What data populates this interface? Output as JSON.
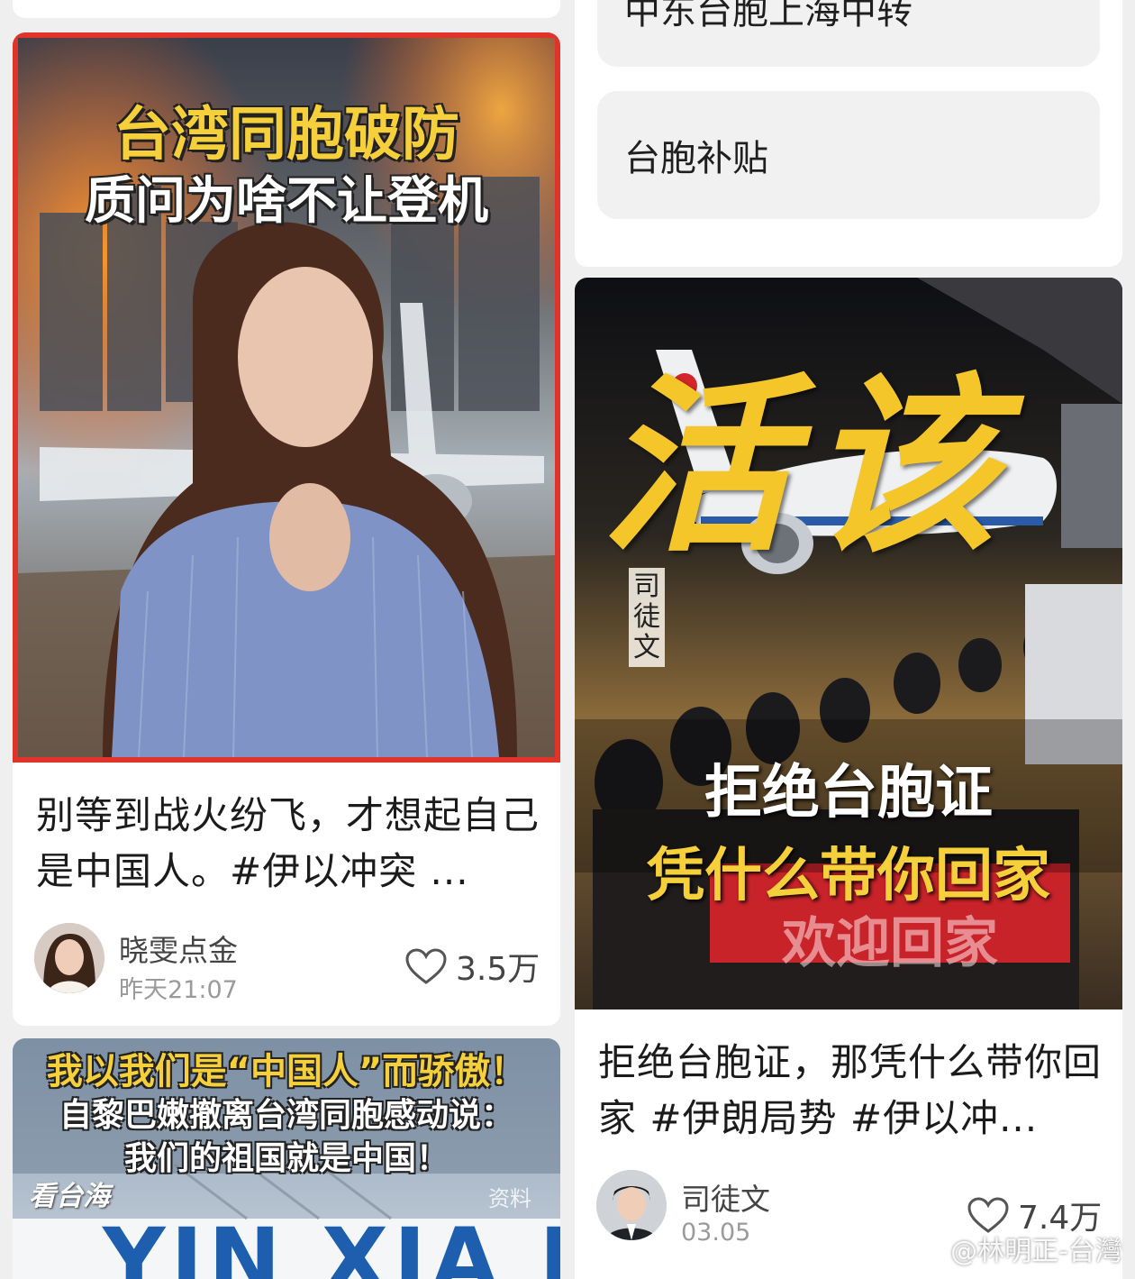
{
  "left_column": {
    "card1": {
      "cover_headline_1": "台湾同胞破防",
      "cover_headline_2": "质问为啥不让登机",
      "title": "别等到战火纷飞，才想起自己是中国人。#伊以冲突 ...",
      "author": "晓雯点金",
      "time": "昨天21:07",
      "likes": "3.5万"
    },
    "card2": {
      "cover_line_1": "我以我们是“中国人”而骄傲！",
      "cover_line_2": "自黎巴嫩撤离台湾同胞感动说：",
      "cover_line_3": "我们的祖国就是中国！",
      "cover_logo": "看台海",
      "cover_source": "资料",
      "cover_ship_text": "YIN XIA ME"
    }
  },
  "right_column": {
    "topic_chips": [
      "中东台胞上海中转",
      "台胞补贴"
    ],
    "card3": {
      "cover_calligraphy": "活该",
      "cover_vertical_name": "司徒文",
      "cover_line_1": "拒绝台胞证",
      "cover_line_2": "凭什么带你回家",
      "cover_banner": "欢迎回家",
      "title": "拒绝台胞证，那凭什么带你回家 #伊朗局势 #伊以冲...",
      "author": "司徒文",
      "time": "03.05",
      "likes": "7.4万"
    }
  },
  "watermark": "@林明正-台灣",
  "colors": {
    "card_bg": "#ffffff",
    "page_bg": "#efefef",
    "chip_bg": "#f1f1f1",
    "cover1_border": "#e0332a",
    "headline_yellow": "#f6d03a"
  }
}
